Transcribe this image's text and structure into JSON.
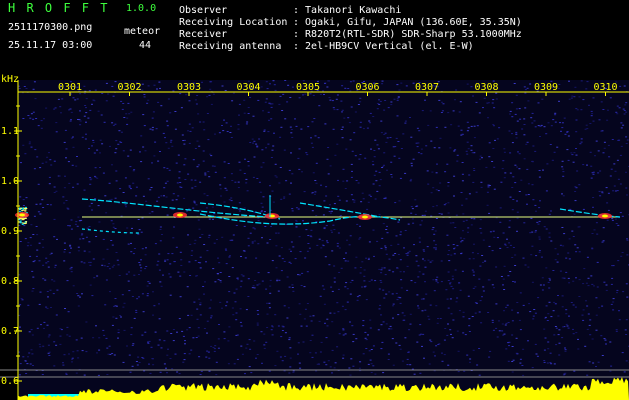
{
  "header": {
    "app_title": "H R O F F T",
    "version": "1.0.0",
    "filename": "2511170300.png",
    "datetime": "25.11.17 03:00",
    "meteor_label": "meteor",
    "meteor_count": "44",
    "observer_label": "Observer",
    "observer_value": ": Takanori Kawachi",
    "location_label": "Receiving Location",
    "location_value": ": Ogaki, Gifu, JAPAN (136.60E, 35.35N)",
    "receiver_label": "Receiver",
    "receiver_value": ": R820T2(RTL-SDR) SDR-Sharp 53.1000MHz",
    "antenna_label": "Receiving antenna",
    "antenna_value": ": 2el-HB9CV Vertical (el. E-W)"
  },
  "axis": {
    "unit": "kHz",
    "y_ticks": [
      "1.1",
      "1.0",
      "0.9",
      "0.8",
      "0.7",
      "0.6"
    ],
    "x_ticks": [
      "0301",
      "0302",
      "0303",
      "0304",
      "0305",
      "0306",
      "0307",
      "0308",
      "0309",
      "0310"
    ]
  },
  "colors": {
    "background": "#000000",
    "title_green": "#3dff3d",
    "text_white": "#ffffff",
    "tick_yellow": "#ffff00",
    "noise_blue": "#1e1e8c",
    "echo_cyan": "#00ffff",
    "level_yellow": "#ffff00"
  }
}
